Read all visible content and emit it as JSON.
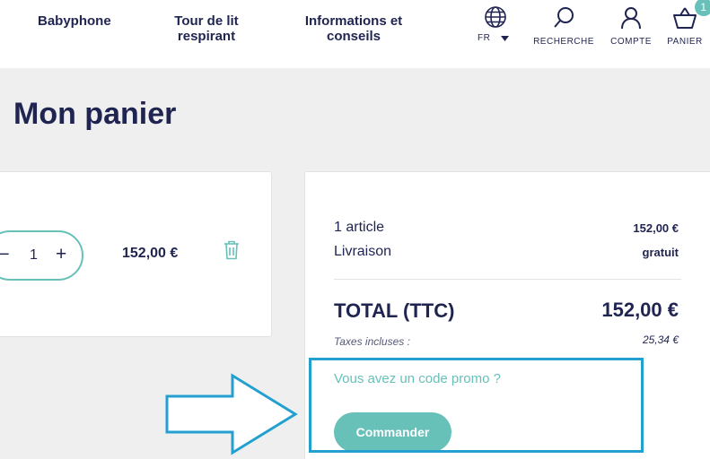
{
  "nav": {
    "babyphone": "Babyphone",
    "tour_line1": "Tour de lit",
    "tour_line2": "respirant",
    "info_line1": "Informations et",
    "info_line2": "conseils"
  },
  "header_icons": {
    "language": "FR",
    "search": "RECHERCHE",
    "account": "COMPTE",
    "cart": "PANIER",
    "cart_count": "1"
  },
  "page_title": "Mon panier",
  "cart_item": {
    "quantity": "1",
    "minus": "−",
    "plus": "+",
    "price": "152,00 €"
  },
  "summary": {
    "articles_label": "1 article",
    "articles_value": "152,00 €",
    "shipping_label": "Livraison",
    "shipping_value": "gratuit",
    "total_label": "TOTAL (TTC)",
    "total_value": "152,00 €",
    "tax_label": "Taxes incluses :",
    "tax_value": "25,34 €",
    "promo_link": "Vous avez un code promo ?",
    "order_button": "Commander"
  },
  "colors": {
    "accent": "#67c1b9",
    "navy": "#1f2450",
    "highlight": "#23a0d0"
  }
}
